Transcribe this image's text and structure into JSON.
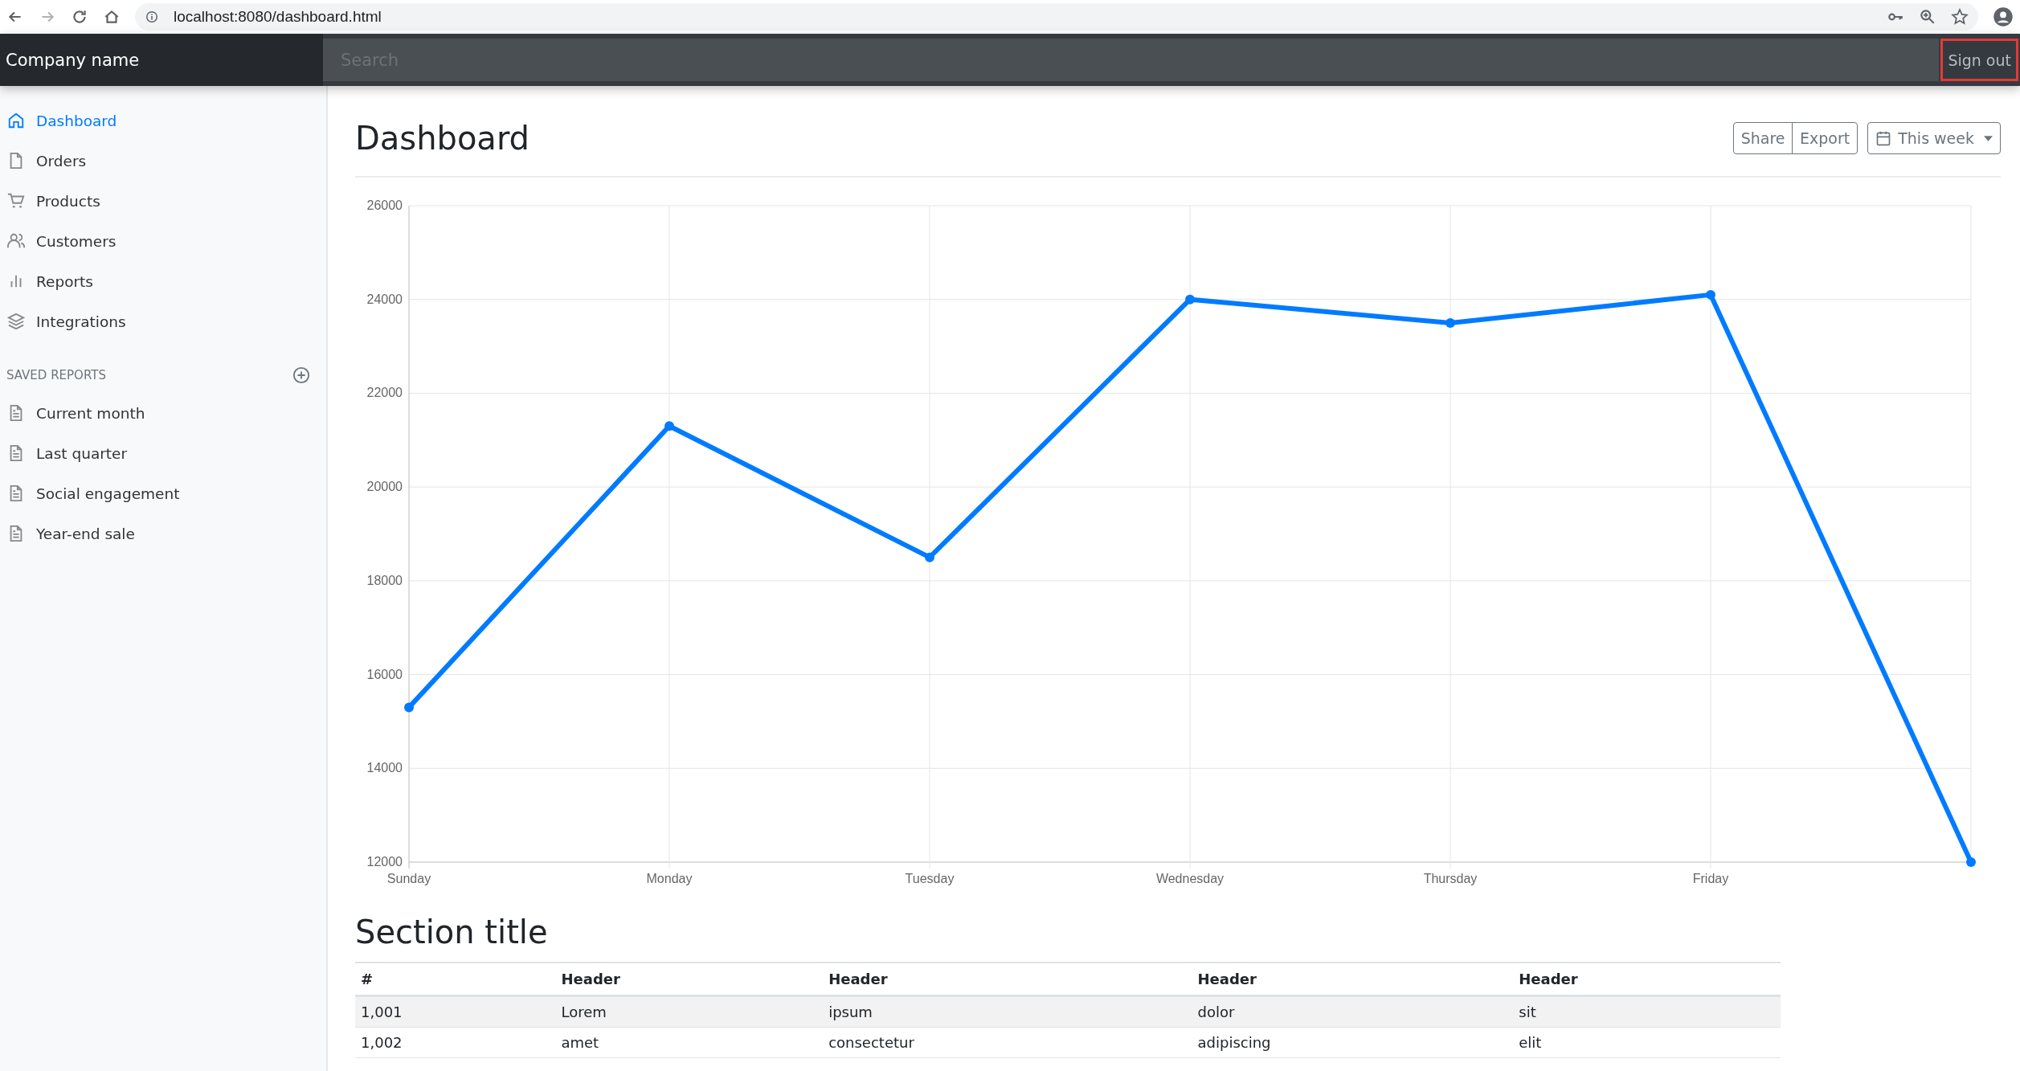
{
  "browser": {
    "url": "localhost:8080/dashboard.html"
  },
  "navbar": {
    "brand": "Company name",
    "search": {
      "placeholder": "Search"
    },
    "sign_out": "Sign out"
  },
  "sidebar": {
    "items": [
      {
        "label": "Dashboard",
        "selected": true
      },
      {
        "label": "Orders",
        "selected": false
      },
      {
        "label": "Products",
        "selected": false
      },
      {
        "label": "Customers",
        "selected": false
      },
      {
        "label": "Reports",
        "selected": false
      },
      {
        "label": "Integrations",
        "selected": false
      }
    ],
    "saved_reports": {
      "heading": "SAVED REPORTS",
      "items": [
        "Current month",
        "Last quarter",
        "Social engagement",
        "Year-end sale"
      ]
    }
  },
  "page": {
    "title": "Dashboard",
    "buttons": [
      "Share",
      "Export"
    ],
    "range": "This week"
  },
  "chart": {
    "chart_data": {
      "type": "line",
      "categories": [
        "Sunday",
        "Monday",
        "Tuesday",
        "Wednesday",
        "Thursday",
        "Friday",
        null
      ],
      "grid": true,
      "ylim": [
        12000,
        26000
      ],
      "yticks": [
        12000,
        14000,
        16000,
        18000,
        20000,
        22000,
        24000,
        26000
      ],
      "series": [
        {
          "color": "#007bff",
          "marker": true,
          "values": [
            15300,
            21300,
            18500,
            24000,
            23500,
            24100,
            12000
          ]
        }
      ]
    }
  },
  "section": {
    "title": "Section title",
    "table": {
      "columns": [
        "#",
        "Header",
        "Header",
        "Header",
        "Header"
      ],
      "rows": [
        [
          "1,001",
          "Lorem",
          "ipsum",
          "dolor",
          "sit"
        ],
        [
          "1,002",
          "amet",
          "consectetur",
          "adipiscing",
          "elit"
        ]
      ]
    }
  }
}
